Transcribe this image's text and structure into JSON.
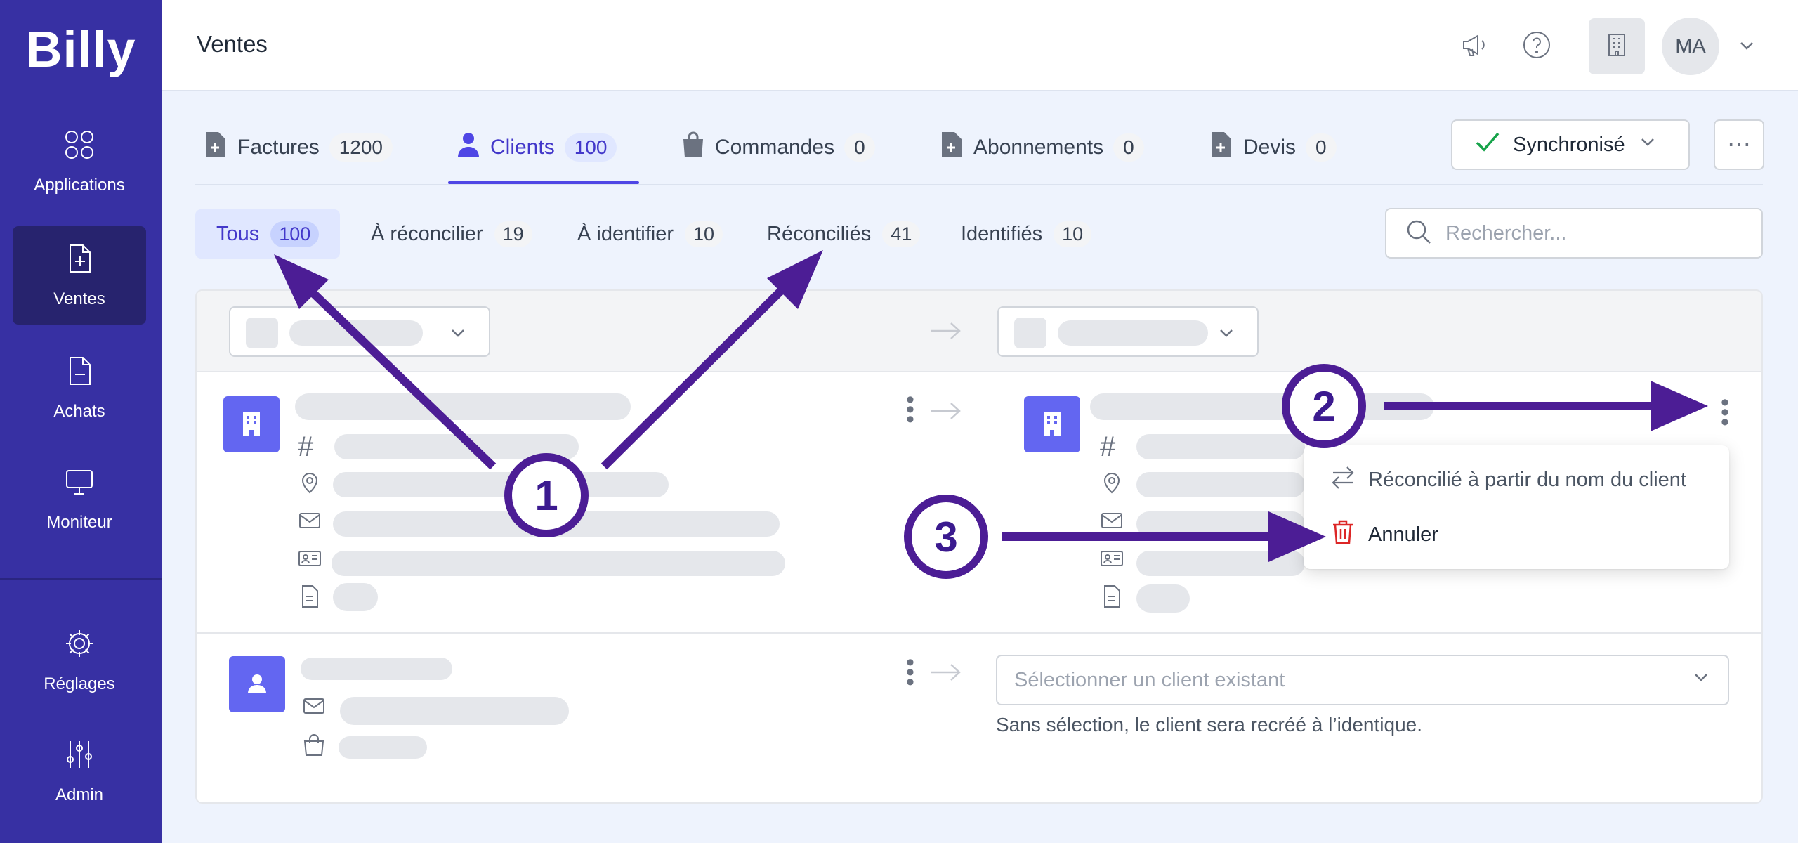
{
  "sidebar": {
    "logo": "Billy",
    "items": [
      {
        "label": "Applications"
      },
      {
        "label": "Ventes"
      },
      {
        "label": "Achats"
      },
      {
        "label": "Moniteur"
      },
      {
        "label": "Réglages"
      },
      {
        "label": "Admin"
      }
    ]
  },
  "header": {
    "title": "Ventes",
    "avatar_initials": "MA"
  },
  "tabs": [
    {
      "label": "Factures",
      "count": "1200"
    },
    {
      "label": "Clients",
      "count": "100"
    },
    {
      "label": "Commandes",
      "count": "0"
    },
    {
      "label": "Abonnements",
      "count": "0"
    },
    {
      "label": "Devis",
      "count": "0"
    }
  ],
  "sync": {
    "label": "Synchronisé"
  },
  "filters": [
    {
      "label": "Tous",
      "count": "100"
    },
    {
      "label": "À réconcilier",
      "count": "19"
    },
    {
      "label": "À identifier",
      "count": "10"
    },
    {
      "label": "Réconciliés",
      "count": "41"
    },
    {
      "label": "Identifiés",
      "count": "10"
    }
  ],
  "search": {
    "placeholder": "Rechercher..."
  },
  "menu": {
    "reconciled_label": "Réconcilié à partir du nom du client",
    "cancel_label": "Annuler"
  },
  "client_select": {
    "placeholder": "Sélectionner un client existant",
    "hint": "Sans sélection, le client sera recréé à l’identique."
  },
  "annotations": {
    "badge1": "1",
    "badge2": "2",
    "badge3": "3"
  },
  "colors": {
    "sidebar": "#3730a3",
    "accent": "#4f46e5",
    "annotation": "#4c1d95",
    "danger": "#dc2626",
    "success": "#16a34a"
  }
}
